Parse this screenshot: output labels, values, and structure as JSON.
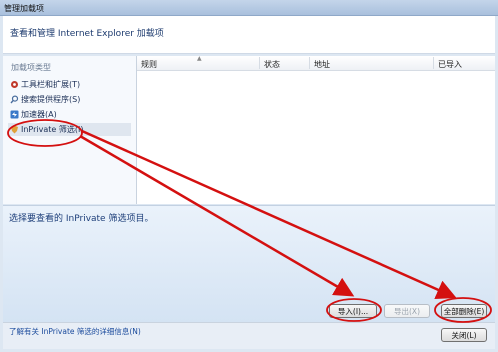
{
  "window": {
    "title": "管理加载项"
  },
  "header": {
    "title": "查看和管理 Internet Explorer 加载项"
  },
  "sidebar": {
    "section_label": "加载项类型",
    "items": [
      {
        "label": "工具栏和扩展(T)",
        "icon": "gear-icon"
      },
      {
        "label": "搜索提供程序(S)",
        "icon": "search-icon"
      },
      {
        "label": "加速器(A)",
        "icon": "accelerator-icon"
      },
      {
        "label": "InPrivate 筛选(I)",
        "icon": "inprivate-icon",
        "selected": true
      }
    ]
  },
  "table": {
    "columns": [
      "规则",
      "状态",
      "地址",
      "已导入"
    ],
    "rows": []
  },
  "info": {
    "message": "选择要查看的 InPrivate 筛选项目。"
  },
  "buttons": {
    "import": "导入(I)...",
    "export": "导出(X)",
    "delete_all": "全部删除(E)",
    "close": "关闭(L)"
  },
  "footer": {
    "link": "了解有关 InPrivate 筛选的详细信息(N)"
  },
  "colors": {
    "annotation": "#d41010",
    "accent": "#1a4a9c"
  }
}
